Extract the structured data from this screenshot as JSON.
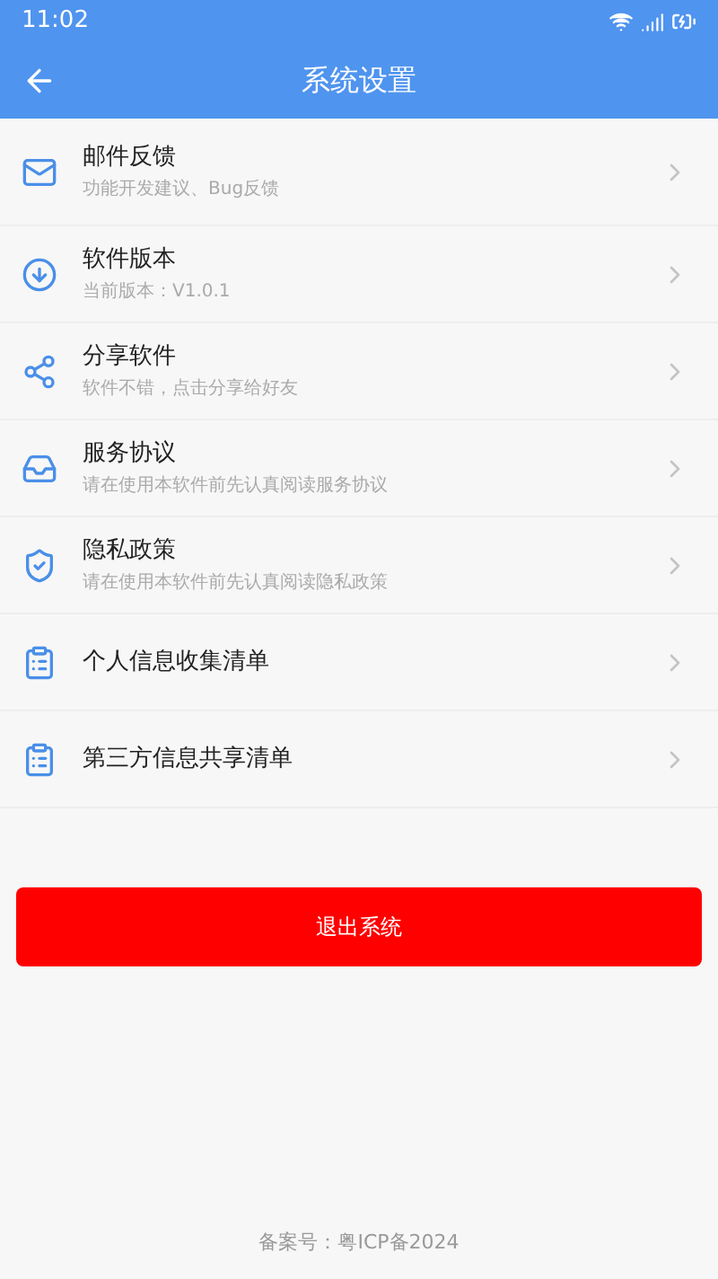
{
  "status_bar": {
    "time": "11:02"
  },
  "app_bar": {
    "title": "系统设置"
  },
  "settings": [
    {
      "title": "邮件反馈",
      "subtitle": "功能开发建议、Bug反馈"
    },
    {
      "title": "软件版本",
      "subtitle": "当前版本：V1.0.1"
    },
    {
      "title": "分享软件",
      "subtitle": "软件不错，点击分享给好友"
    },
    {
      "title": "服务协议",
      "subtitle": "请在使用本软件前先认真阅读服务协议"
    },
    {
      "title": "隐私政策",
      "subtitle": "请在使用本软件前先认真阅读隐私政策"
    },
    {
      "title": "个人信息收集清单"
    },
    {
      "title": "第三方信息共享清单"
    }
  ],
  "logout_button": "退出系统",
  "footer": "备案号：粤ICP备2024"
}
